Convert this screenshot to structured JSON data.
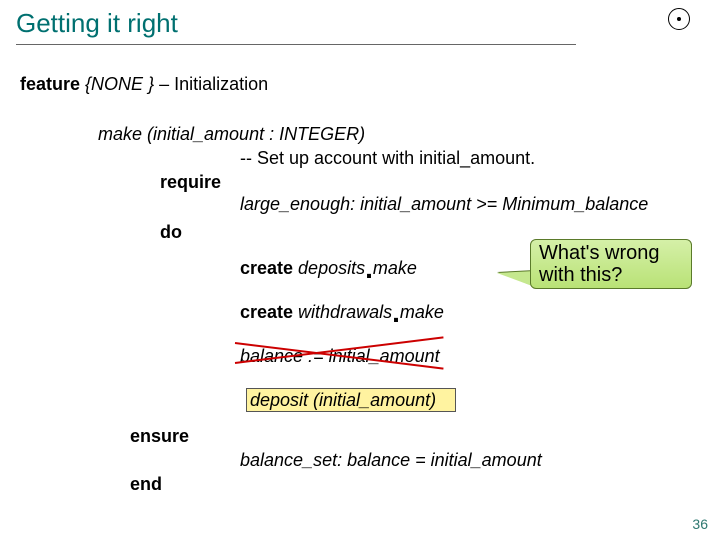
{
  "title": "Getting it right",
  "featureLine": {
    "kw": "feature",
    "scope": "{NONE }",
    "suffix": " – Initialization"
  },
  "make": {
    "sig_pre": "make",
    "sig_mid": " (initial_amount ",
    "sig_post": ": INTEGER)",
    "comment": "-- Set up account with initial_amount."
  },
  "require": {
    "kw": "require",
    "cond": "large_enough: initial_amount >= Minimum_balance"
  },
  "doKw": "do",
  "create1": {
    "kw": "create",
    "rest_a": " deposits",
    "rest_b": "make"
  },
  "create2": {
    "kw": "create",
    "rest_a": " withdrawals",
    "rest_b": "make"
  },
  "balance_assign": "balance := initial_amount",
  "deposit_call": "deposit (initial_amount)",
  "ensure": {
    "kw": "ensure",
    "cond": "balance_set: balance = initial_amount"
  },
  "endKw": "end",
  "callout": "What's wrong with this?",
  "pagenum": "36"
}
